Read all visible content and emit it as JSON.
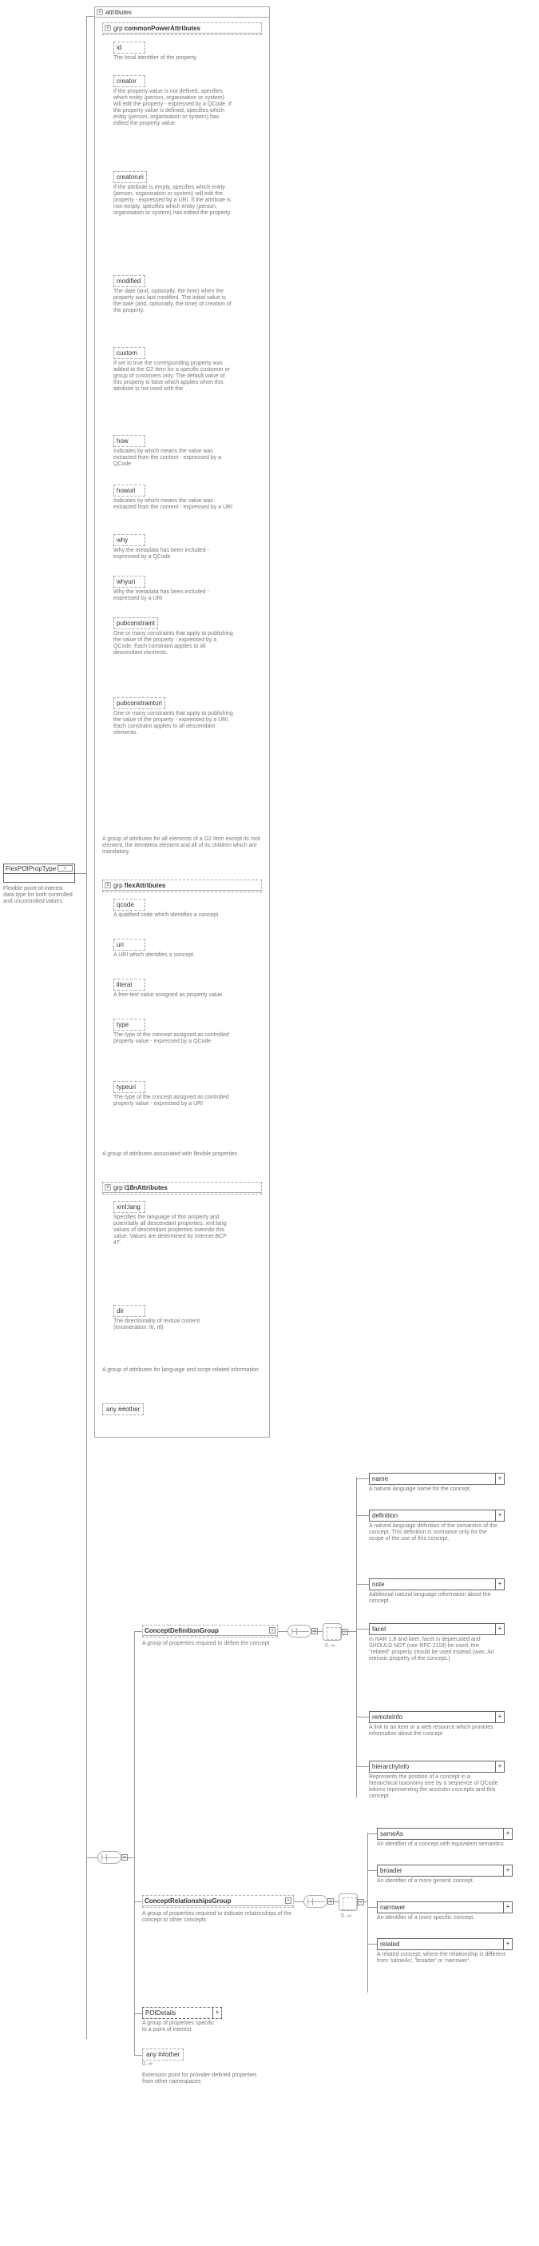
{
  "root": {
    "name": "FlexPOIPropType",
    "desc": "Flexible point-of-interest data type for both controlled and uncontrolled values"
  },
  "attributes_label": "attributes",
  "grp_prefix": "grp",
  "plus": "+",
  "card_0inf": "0..∞",
  "groups": {
    "cpa": {
      "title": "commonPowerAttributes",
      "desc": "A group of attributes for all elements of a G2 Item except its root element, the itemMeta element and all of its children which are mandatory.",
      "attrs": [
        {
          "n": "id",
          "d": "The local identifier of the property."
        },
        {
          "n": "creator",
          "d": "If the property value is not defined, specifies which entity (person, organisation or system) will edit the property - expressed by a QCode. If the property value is defined, specifies which entity (person, organisation or system) has edited the property value."
        },
        {
          "n": "creatoruri",
          "d": "If the attribute is empty, specifies which entity (person, organisation or system) will edit the property - expressed by a URI. If the attribute is non-empty, specifies which entity (person, organisation or system) has edited the property."
        },
        {
          "n": "modified",
          "d": "The date (and, optionally, the time) when the property was last modified. The initial value is the date (and, optionally, the time) of creation of the property."
        },
        {
          "n": "custom",
          "d": "If set to true the corresponding property was added to the G2 Item for a specific customer or group of customers only. The default value of this property is false which applies when this attribute is not used with the"
        },
        {
          "n": "how",
          "d": "Indicates by which means the value was extracted from the content - expressed by a QCode"
        },
        {
          "n": "howuri",
          "d": "Indicates by which means the value was extracted from the content - expressed by a URI"
        },
        {
          "n": "why",
          "d": "Why the metadata has been included - expressed by a QCode"
        },
        {
          "n": "whyuri",
          "d": "Why the metadata has been included - expressed by a URI"
        },
        {
          "n": "pubconstraint",
          "d": "One or many constraints that apply to publishing the value of the property - expressed by a QCode. Each constraint applies to all descendant elements."
        },
        {
          "n": "pubconstrainturi",
          "d": "One or many constraints that apply to publishing the value of the property - expressed by a URI. Each constraint applies to all descendant elements."
        }
      ]
    },
    "flex": {
      "title": "flexAttributes",
      "desc": "A group of attributes associated with flexible properties",
      "attrs": [
        {
          "n": "qcode",
          "d": "A qualified code which identifies a concept."
        },
        {
          "n": "uri",
          "d": "A URI which identifies a concept."
        },
        {
          "n": "literal",
          "d": "A free-text value assigned as property value."
        },
        {
          "n": "type",
          "d": "The type of the concept assigned as controlled property value - expressed by a QCode"
        },
        {
          "n": "typeuri",
          "d": "The type of the concept assigned as controlled property value - expressed by a URI"
        }
      ]
    },
    "i18n": {
      "title": "i18nAttributes",
      "desc": "A group of attributes for language and script related information",
      "attrs": [
        {
          "n": "xml:lang",
          "d": "Specifies the language of this property and potentially all descendant properties. xml:lang values of descendant properties override this value. Values are determined by Internet BCP 47."
        },
        {
          "n": "dir",
          "d": "The directionality of textual content (enumeration: ltr, rtl)"
        }
      ]
    }
  },
  "any_top": "any ##other",
  "cdg": {
    "title": "ConceptDefinitionGroup",
    "desc": "A group of properties required to define the concept"
  },
  "crg": {
    "title": "ConceptRelationshipsGroup",
    "desc": "A group of properties required to indicate relationships of the concept to other concepts"
  },
  "poi": {
    "title": "POIDetails",
    "desc": "A group of properties specific to a point of interest"
  },
  "any_bot": {
    "label": "any ##other",
    "desc": "Extension point for provider-defined properties from other namespaces"
  },
  "leaves_cdg": [
    {
      "n": "name",
      "d": "A natural language name for the concept."
    },
    {
      "n": "definition",
      "d": "A natural language definition of the semantics of the concept. This definition is normative only for the scope of the use of this concept."
    },
    {
      "n": "note",
      "d": "Additional natural language information about the concept."
    },
    {
      "n": "facet",
      "d": "In NAR 1.8 and later, facet is deprecated and SHOULD NOT (see RFC 2119) be used, the \"related\" property should be used instead.(was: An intrinsic property of the concept.)"
    },
    {
      "n": "remoteInfo",
      "d": "A link to an item or a web resource which provides information about the concept"
    },
    {
      "n": "hierarchyInfo",
      "d": "Represents the position of a concept in a hierarchical taxonomy tree by a sequence of QCode tokens representing the ancestor concepts and this concept"
    }
  ],
  "leaves_crg": [
    {
      "n": "sameAs",
      "d": "An identifier of a concept with equivalent semantics"
    },
    {
      "n": "broader",
      "d": "An identifier of a more generic concept."
    },
    {
      "n": "narrower",
      "d": "An identifier of a more specific concept."
    },
    {
      "n": "related",
      "d": "A related concept, where the relationship is different from 'sameAs', 'broader' or 'narrower'."
    }
  ]
}
